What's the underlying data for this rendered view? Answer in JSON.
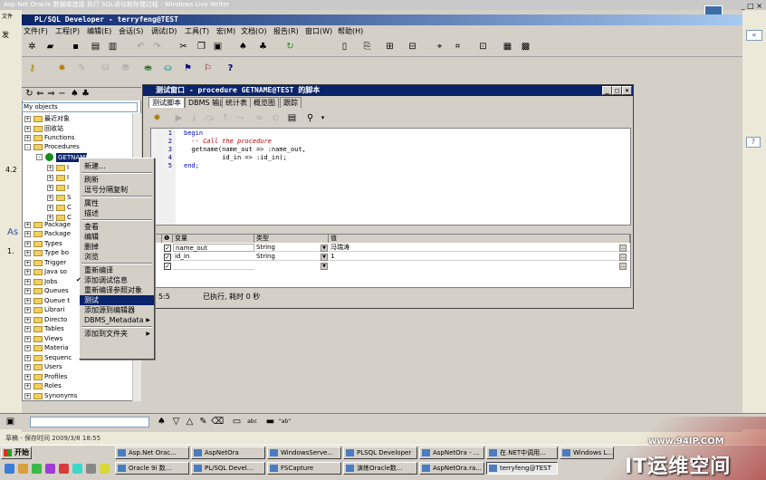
{
  "outer": {
    "title": "Asp.Net Oracle 数据库连接 执行 SQL语句和存储过程 - Windows Live Writer",
    "left_labels": [
      "文件",
      "发",
      "4.2",
      "As",
      "1."
    ]
  },
  "plsql": {
    "title": "PL/SQL Developer - terryfeng@TEST",
    "menu": [
      "文件(F)",
      "工程(P)",
      "编辑(E)",
      "会话(S)",
      "调试(D)",
      "工具(T)",
      "宏(M)",
      "文档(O)",
      "报告(R)",
      "窗口(W)",
      "帮助(H)"
    ]
  },
  "object_browser": {
    "selector": "My objects",
    "tree": [
      {
        "label": "最近对象",
        "exp": "+"
      },
      {
        "label": "回收站",
        "exp": "+"
      },
      {
        "label": "Functions",
        "exp": "+"
      },
      {
        "label": "Procedures",
        "exp": "-"
      },
      {
        "label": "GETNAME",
        "exp": "-"
      },
      {
        "label": "Package",
        "exp": "+"
      },
      {
        "label": "Package",
        "exp": "+"
      },
      {
        "label": "Types",
        "exp": "+"
      },
      {
        "label": "Type bo",
        "exp": "+"
      },
      {
        "label": "Trigger",
        "exp": "+"
      },
      {
        "label": "Java so",
        "exp": "+"
      },
      {
        "label": "Jobs",
        "exp": "+"
      },
      {
        "label": "Queues",
        "exp": "+"
      },
      {
        "label": "Queue t",
        "exp": "+"
      },
      {
        "label": "Librari",
        "exp": "+"
      },
      {
        "label": "Directo",
        "exp": "+"
      },
      {
        "label": "Tables",
        "exp": "+"
      },
      {
        "label": "Views",
        "exp": "+"
      },
      {
        "label": "Materia",
        "exp": "+"
      },
      {
        "label": "Sequenc",
        "exp": "+"
      },
      {
        "label": "Users",
        "exp": "+"
      },
      {
        "label": "Profiles",
        "exp": "+"
      },
      {
        "label": "Roles",
        "exp": "+"
      },
      {
        "label": "Synonyms",
        "exp": "+"
      }
    ],
    "sub_items": [
      "I",
      "I",
      "I",
      "S",
      "C",
      "C"
    ]
  },
  "test_window": {
    "title": "测试窗口 - procedure GETNAME@TEST 的脚本",
    "tabs": [
      "测试脚本",
      "DBMS 输出",
      "统计表",
      "概览图",
      "跟踪"
    ],
    "code": [
      "begin",
      "  -- Call the procedure",
      "  getname(name_out => :name_out,",
      "          id_in => :id_in);",
      "end;"
    ],
    "line_numbers": [
      "1",
      "2",
      "3",
      "4",
      "5"
    ],
    "grid_headers": [
      "变量",
      "类型",
      "值"
    ],
    "grid_rows": [
      {
        "var": "name_out",
        "type": "String",
        "value": "冯瑞涛"
      },
      {
        "var": "id_in",
        "type": "String",
        "value": "1"
      }
    ],
    "status_pos": "5:5",
    "status_text": "已执行, 耗时 0 秒"
  },
  "context_menu": {
    "items": [
      {
        "label": "新建...",
        "type": "item"
      },
      {
        "type": "sep"
      },
      {
        "label": "刷新",
        "type": "item"
      },
      {
        "label": "逗号分隔复制",
        "type": "item"
      },
      {
        "type": "sep"
      },
      {
        "label": "属性",
        "type": "item"
      },
      {
        "label": "描述",
        "type": "item"
      },
      {
        "type": "sep"
      },
      {
        "label": "查看",
        "type": "item"
      },
      {
        "label": "编辑",
        "type": "item"
      },
      {
        "label": "删掉",
        "type": "item"
      },
      {
        "label": "浏览",
        "type": "item"
      },
      {
        "type": "sep"
      },
      {
        "label": "重新编译",
        "type": "item"
      },
      {
        "label": "添加调试信息",
        "type": "item",
        "checked": true
      },
      {
        "label": "重新编译参照对象",
        "type": "item"
      },
      {
        "label": "测试",
        "type": "item",
        "highlighted": true
      },
      {
        "label": "添加源到编辑器",
        "type": "item"
      },
      {
        "label": "DBMS_Metadata",
        "type": "item",
        "submenu": true
      },
      {
        "type": "sep"
      },
      {
        "label": "添加到文件夹",
        "type": "item",
        "submenu": true
      }
    ]
  },
  "bottom": {
    "status": "草稿 - 保存时间 2009/3/8 18:55",
    "start": "开始",
    "tasks_row1": [
      "Asp.Net Orac...",
      "AspNetOra",
      "WindowsServe...",
      "PLSQL Developer",
      "AspNetOra - ...",
      "在.NET中调用...",
      "Windows L..."
    ],
    "tasks_row2": [
      "Oracle 9i 数...",
      "PL/SQL Devel...",
      "FSCapture",
      "演练Oracle数...",
      "AspNetOra.ra...",
      "terryfeng@TEST"
    ]
  },
  "watermark": {
    "url": "www.94IP.COM",
    "text": "IT运维空间"
  }
}
